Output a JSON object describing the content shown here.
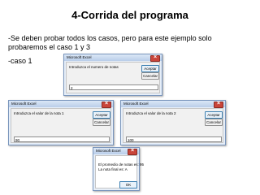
{
  "page": {
    "title": "4-Corrida del programa",
    "description": "-Se deben probar todos los casos, pero para este ejemplo solo probaremos el caso 1 y 3",
    "case_label": "-caso 1"
  },
  "dialogs": {
    "d1": {
      "title": "Microsoft Excel",
      "prompt": "Introduzca el numero de notas",
      "accept": "Aceptar",
      "cancel": "Cancelar",
      "value": "2"
    },
    "d2": {
      "title": "Microsoft Excel",
      "prompt": "Introduzca el valor de la nota 1",
      "accept": "Aceptar",
      "cancel": "Cancelar",
      "value": "90"
    },
    "d3": {
      "title": "Microsoft Excel",
      "prompt": "Introduzca el valor de la nota 2",
      "accept": "Aceptar",
      "cancel": "Cancelar",
      "value": "100"
    },
    "d4": {
      "title": "Microsoft Excel",
      "line1": "El promedio de notas es: 95",
      "line2": "La nota final es: A",
      "ok": "OK"
    }
  }
}
